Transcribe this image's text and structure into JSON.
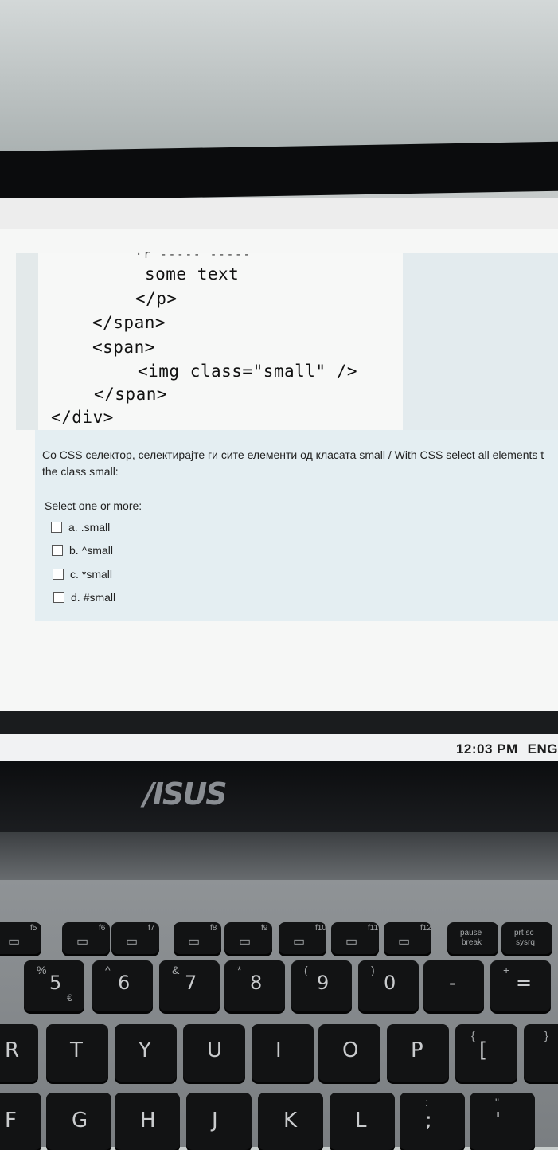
{
  "code": {
    "cut_line": "·r ----- -----",
    "lines": [
      "some text",
      "</p>",
      "</span>",
      "<span>",
      "<img class=\"small\" />",
      "</span>",
      "</div>"
    ]
  },
  "question": {
    "text_line1": "Со CSS селектор, селектирајте ги сите елементи од класата small / With CSS select all elements t",
    "text_line2": "the class small:",
    "select_label": "Select one or more:",
    "options": [
      {
        "letter": "a.",
        "label": ".small"
      },
      {
        "letter": "b.",
        "label": "^small"
      },
      {
        "letter": "c.",
        "label": "*small"
      },
      {
        "letter": "d.",
        "label": "#small"
      }
    ]
  },
  "taskbar": {
    "time": "12:03 PM",
    "lang": "ENG"
  },
  "laptop": {
    "brand": "/ISUS"
  },
  "keyboard": {
    "fn_row": [
      {
        "fn": "f5",
        "icon": "display-icon"
      },
      {
        "fn": "f6",
        "icon": "brightness-icon"
      },
      {
        "fn": "f7",
        "icon": "touchpad-off-icon"
      },
      {
        "fn": "f8",
        "icon": "projector-icon"
      },
      {
        "fn": "f9",
        "icon": "touchpad-icon"
      },
      {
        "fn": "f10",
        "icon": "mute-icon"
      },
      {
        "fn": "f11",
        "icon": "volume-down-icon"
      },
      {
        "fn": "f12",
        "icon": "volume-up-icon"
      },
      {
        "fn": "pause",
        "sub": "break"
      },
      {
        "fn": "prt sc",
        "sub": "sysrq"
      }
    ],
    "number_row": [
      {
        "main": "5",
        "top": "%",
        "sub": "€"
      },
      {
        "main": "6",
        "top": "^"
      },
      {
        "main": "7",
        "top": "&"
      },
      {
        "main": "8",
        "top": "*"
      },
      {
        "main": "9",
        "top": "("
      },
      {
        "main": "0",
        "top": ")"
      },
      {
        "main": "-",
        "top": "_"
      },
      {
        "main": "=",
        "top": "+"
      }
    ],
    "row_qwerty": [
      "R",
      "T",
      "Y",
      "U",
      "I",
      "O",
      "P",
      "["
    ],
    "row_qwerty_top": [
      "",
      "",
      "",
      "",
      "",
      "",
      "",
      "{"
    ],
    "row_home": [
      "F",
      "G",
      "H",
      "J",
      "K",
      "L",
      ";",
      "'"
    ],
    "row_home_top": [
      "",
      "",
      "",
      "",
      "",
      "",
      ":",
      "\""
    ],
    "bracket_close_top": "}"
  }
}
